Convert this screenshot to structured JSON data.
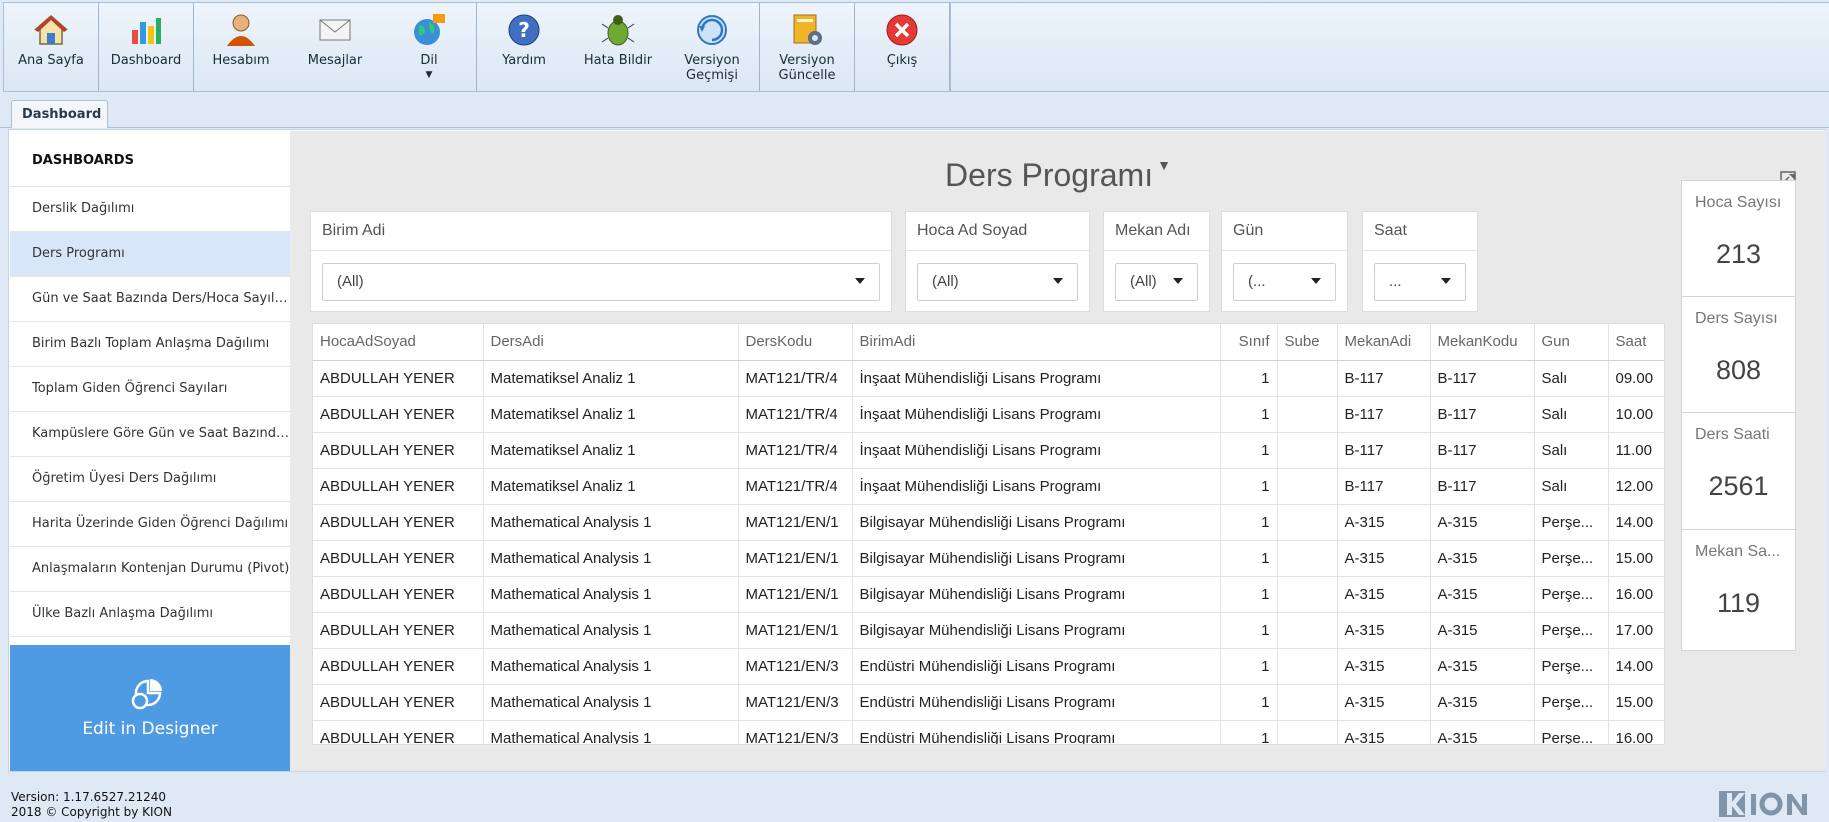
{
  "toolbar": {
    "home": "Ana Sayfa",
    "dashboard": "Dashboard",
    "account": "Hesabım",
    "messages": "Mesajlar",
    "language": "Dil",
    "help": "Yardım",
    "report_bug": "Hata Bildir",
    "version_history_1": "Versiyon",
    "version_history_2": "Geçmişi",
    "version_update_1": "Versiyon",
    "version_update_2": "Güncelle",
    "exit": "Çıkış"
  },
  "tabs": {
    "active": "Dashboard"
  },
  "sidebar": {
    "header": "DASHBOARDS",
    "items": [
      "Derslik Dağılımı",
      "Ders Programı",
      "Gün ve Saat Bazında Ders/Hoca Sayıları",
      "Birim Bazlı Toplam Anlaşma Dağılımı",
      "Toplam Giden Öğrenci Sayıları",
      "Kampüslere Göre Gün ve Saat Bazında Ders/Hoca Sayıları",
      "Öğretim Üyesi Ders Dağılımı",
      "Harita Üzerinde Giden Öğrenci Dağılımı",
      "Anlaşmaların Kontenjan Durumu (Pivot)",
      "Ülke Bazlı Anlaşma Dağılımı"
    ],
    "active_index": 1,
    "edit_designer": "Edit in Designer"
  },
  "dashboard": {
    "title": "Ders Programı",
    "filters": [
      {
        "label": "Birim Adi",
        "value": "(All)"
      },
      {
        "label": "Hoca Ad Soyad",
        "value": "(All)"
      },
      {
        "label": "Mekan Adı",
        "value": "(All)"
      },
      {
        "label": "Gün",
        "value": "(..."
      },
      {
        "label": "Saat",
        "value": "..."
      }
    ],
    "grid": {
      "columns": [
        "HocaAdSoyad",
        "DersAdi",
        "DersKodu",
        "BirimAdi",
        "Sınıf",
        "Sube",
        "MekanAdi",
        "MekanKodu",
        "Gun",
        "Saat"
      ],
      "rows": [
        [
          "ABDULLAH YENER",
          "Matematiksel Analiz 1",
          "MAT121/TR/4",
          "İnşaat Mühendisliği Lisans Programı",
          "1",
          "",
          "B-117",
          "B-117",
          "Salı",
          "09.00"
        ],
        [
          "ABDULLAH YENER",
          "Matematiksel Analiz 1",
          "MAT121/TR/4",
          "İnşaat Mühendisliği Lisans Programı",
          "1",
          "",
          "B-117",
          "B-117",
          "Salı",
          "10.00"
        ],
        [
          "ABDULLAH YENER",
          "Matematiksel Analiz 1",
          "MAT121/TR/4",
          "İnşaat Mühendisliği Lisans Programı",
          "1",
          "",
          "B-117",
          "B-117",
          "Salı",
          "11.00"
        ],
        [
          "ABDULLAH YENER",
          "Matematiksel Analiz 1",
          "MAT121/TR/4",
          "İnşaat Mühendisliği Lisans Programı",
          "1",
          "",
          "B-117",
          "B-117",
          "Salı",
          "12.00"
        ],
        [
          "ABDULLAH YENER",
          "Mathematical Analysis 1",
          "MAT121/EN/1",
          "Bilgisayar Mühendisliği Lisans Programı",
          "1",
          "",
          "A-315",
          "A-315",
          "Perşe...",
          "14.00"
        ],
        [
          "ABDULLAH YENER",
          "Mathematical Analysis 1",
          "MAT121/EN/1",
          "Bilgisayar Mühendisliği Lisans Programı",
          "1",
          "",
          "A-315",
          "A-315",
          "Perşe...",
          "15.00"
        ],
        [
          "ABDULLAH YENER",
          "Mathematical Analysis 1",
          "MAT121/EN/1",
          "Bilgisayar Mühendisliği Lisans Programı",
          "1",
          "",
          "A-315",
          "A-315",
          "Perşe...",
          "16.00"
        ],
        [
          "ABDULLAH YENER",
          "Mathematical Analysis 1",
          "MAT121/EN/1",
          "Bilgisayar Mühendisliği Lisans Programı",
          "1",
          "",
          "A-315",
          "A-315",
          "Perşe...",
          "17.00"
        ],
        [
          "ABDULLAH YENER",
          "Mathematical Analysis 1",
          "MAT121/EN/3",
          "Endüstri Mühendisliği Lisans Programı",
          "1",
          "",
          "A-315",
          "A-315",
          "Perşe...",
          "14.00"
        ],
        [
          "ABDULLAH YENER",
          "Mathematical Analysis 1",
          "MAT121/EN/3",
          "Endüstri Mühendisliği Lisans Programı",
          "1",
          "",
          "A-315",
          "A-315",
          "Perşe...",
          "15.00"
        ],
        [
          "ABDULLAH YENER",
          "Mathematical Analysis 1",
          "MAT121/EN/3",
          "Endüstri Mühendisliği Lisans Programı",
          "1",
          "",
          "A-315",
          "A-315",
          "Perşe...",
          "16.00"
        ]
      ]
    },
    "kpis": [
      {
        "label": "Hoca Sayısı",
        "value": "213"
      },
      {
        "label": "Ders Sayısı",
        "value": "808"
      },
      {
        "label": "Ders Saati",
        "value": "2561"
      },
      {
        "label": "Mekan Sa...",
        "value": "119"
      }
    ]
  },
  "footer": {
    "version": "Version: 1.17.6527.21240",
    "copyright": "2018 © Copyright by KION"
  },
  "colors": {
    "accent": "#4f9be3",
    "active_item": "#d7e7f9",
    "toolbar_bg": "#dbe7f4"
  }
}
